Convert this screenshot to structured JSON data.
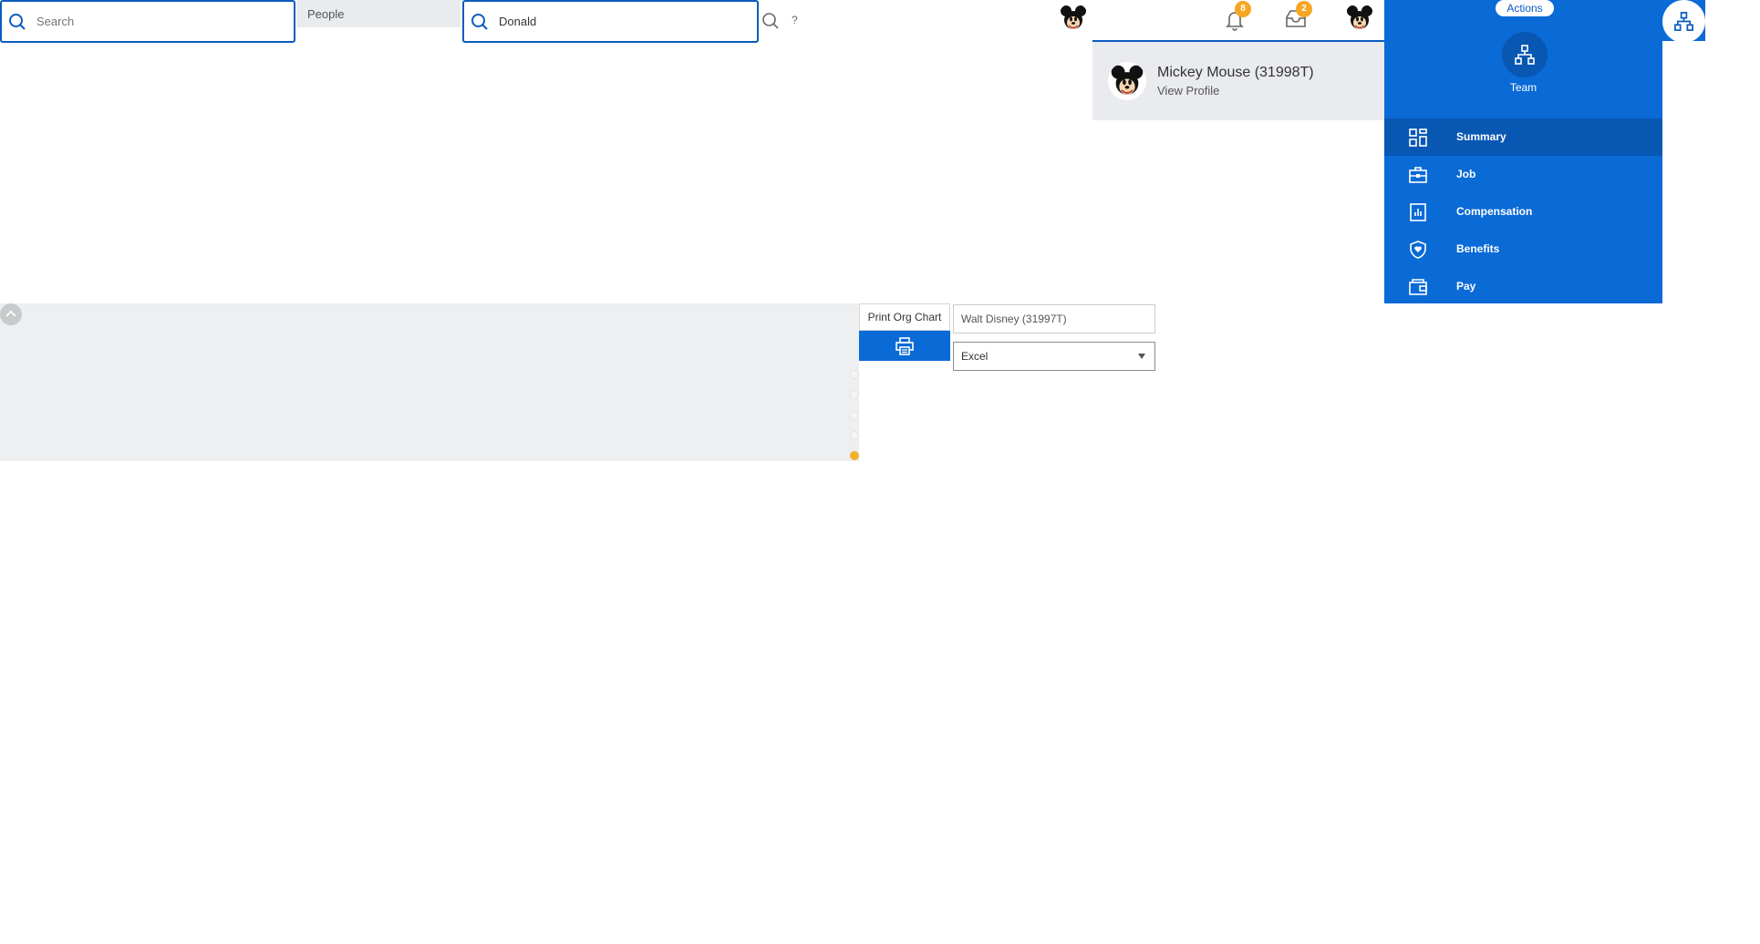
{
  "search": {
    "global_placeholder": "Search",
    "category_tab": "People",
    "people_query": "Donald",
    "help_mark": "?"
  },
  "header": {
    "notifications_count": "8",
    "inbox_count": "2"
  },
  "profile_popup": {
    "name": "Mickey Mouse (31998T)",
    "view_profile_label": "View Profile"
  },
  "side_panel": {
    "actions_label": "Actions",
    "team_label": "Team",
    "nav_items": [
      {
        "label": "Summary",
        "icon": "summary-icon",
        "active": true
      },
      {
        "label": "Job",
        "icon": "job-icon",
        "active": false
      },
      {
        "label": "Compensation",
        "icon": "compensation-icon",
        "active": false
      },
      {
        "label": "Benefits",
        "icon": "benefits-icon",
        "active": false
      },
      {
        "label": "Pay",
        "icon": "pay-icon",
        "active": false
      }
    ]
  },
  "org_chart": {
    "print_label": "Print Org Chart",
    "top_of_chart_value": "Walt Disney (31997T)",
    "format_value": "Excel"
  },
  "colors": {
    "accent_blue": "#0a6ad6",
    "dark_blue": "#0857b3",
    "badge_orange": "#f5a623",
    "panel_gray": "#eeeff0"
  }
}
